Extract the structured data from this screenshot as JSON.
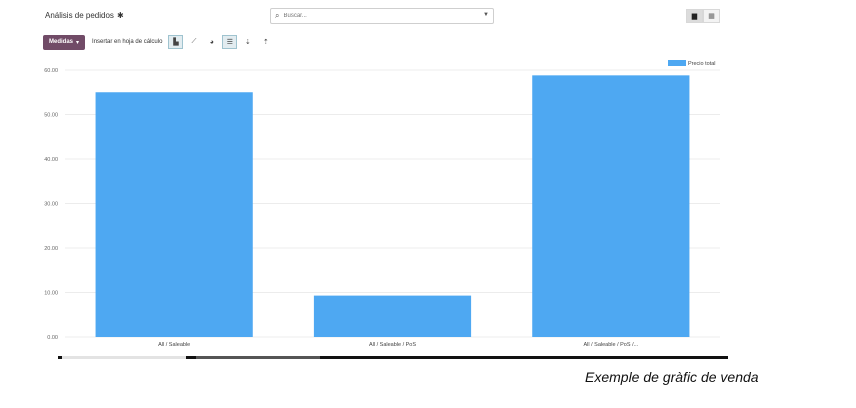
{
  "header": {
    "breadcrumb": "Análisis de pedidos",
    "search_placeholder": "Buscar..."
  },
  "toolbar": {
    "measures_label": "Medidas",
    "insert_label": "Insertar en hoja de cálculo"
  },
  "icons": {
    "settings": "gear-icon",
    "search": "search-icon",
    "dropdown": "caret-down-icon",
    "graph_view": "bar-chart-icon",
    "pivot_view": "pivot-table-icon",
    "bar_chart": "bar-chart-icon",
    "line_chart": "line-chart-icon",
    "pie_chart": "pie-chart-icon",
    "stacked": "stacked-icon",
    "sort_desc": "sort-descending-icon",
    "sort_asc": "sort-ascending-icon"
  },
  "colors": {
    "bar": "#4ea8f2",
    "primary_button": "#714b67"
  },
  "caption": "Exemple de gràfic de venda",
  "chart_data": {
    "type": "bar",
    "categories": [
      "All / Saleable",
      "All / Saleable / PoS",
      "All / Saleable / PoS /..."
    ],
    "series": [
      {
        "name": "Precio total",
        "values": [
          55.0,
          9.3,
          58.8
        ]
      }
    ],
    "yticks": [
      "0.00",
      "10.00",
      "20.00",
      "30.00",
      "40.00",
      "50.00",
      "60.00"
    ],
    "ylim": [
      0,
      60
    ],
    "grid": true,
    "legend": "top-right"
  }
}
